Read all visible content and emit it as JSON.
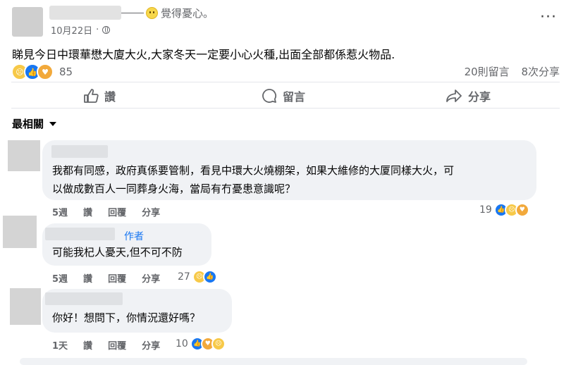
{
  "post": {
    "feeling": "覺得憂心。",
    "date": "10月22日",
    "separator": "·",
    "text": "睇見今日中環華懋大廈大火,大家冬天一定要小心火種,出面全部都係惹火物品.",
    "reaction_count": "85",
    "comments_count": "20則留言",
    "shares_count": "8次分享",
    "more": "···"
  },
  "actions": {
    "like": "讚",
    "comment": "留言",
    "share": "分享"
  },
  "sort_label": "最相關",
  "comments": [
    {
      "text_line1": "我都有同感，政府真係要管制，看見中環大火燒棚架，如果大維修的大厦同樣大火，可",
      "text_line2": "以做成數百人一同葬身火海，當局有冇憂患意識呢？",
      "time": "5週",
      "like": "讚",
      "reply": "回覆",
      "share": "分享",
      "reaction_count": "19"
    },
    {
      "author_badge": "作者",
      "text": "可能我杞人憂天,但不可不防",
      "time": "5週",
      "like": "讚",
      "reply": "回覆",
      "share": "分享",
      "reaction_count": "27"
    },
    {
      "text": "你好！想問下，你情況還好嗎？",
      "time": "1天",
      "like": "讚",
      "reply": "回覆",
      "share": "分享",
      "reaction_count": "10"
    }
  ],
  "icons": [
    "sad-face-icon",
    "like-icon",
    "care-icon",
    "globe-icon",
    "thumb-up-icon",
    "comment-bubble-icon",
    "share-arrow-icon",
    "caret-down-icon",
    "more-dots-icon"
  ],
  "colors": {
    "link_blue": "#1877f2",
    "muted_text": "#65676b",
    "bubble_bg": "#f0f2f5"
  }
}
